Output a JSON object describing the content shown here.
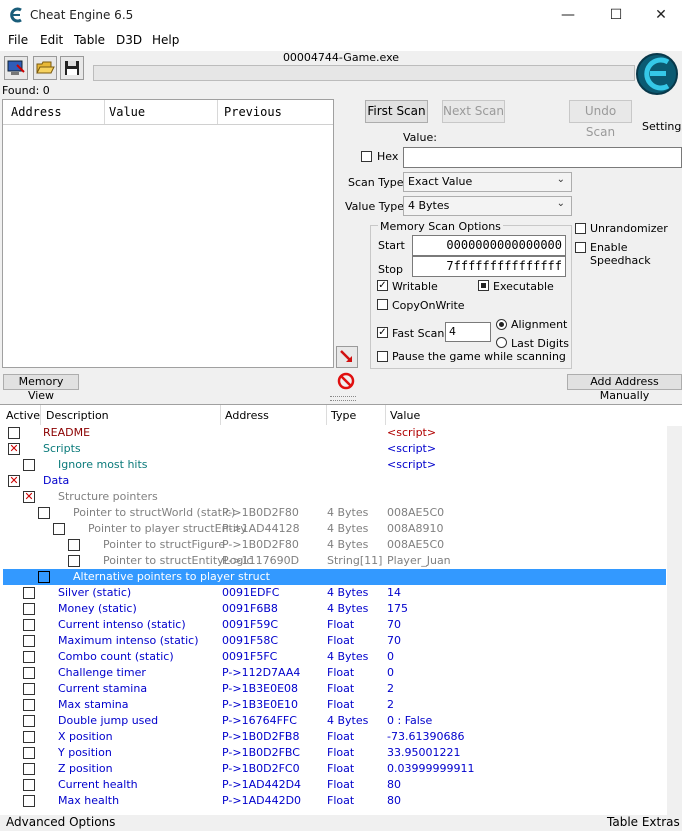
{
  "window": {
    "title": "Cheat Engine 6.5",
    "minimize": "—",
    "maximize": "☐",
    "close": "✕"
  },
  "menu": [
    "File",
    "Edit",
    "Table",
    "D3D",
    "Help"
  ],
  "process": "00004744-Game.exe",
  "found_label": "Found: 0",
  "logo_label": "Settings",
  "results": {
    "columns": [
      "Address",
      "Value",
      "Previous"
    ]
  },
  "scan": {
    "first_scan": "First Scan",
    "next_scan": "Next Scan",
    "undo_scan": "Undo Scan",
    "value_label": "Value:",
    "hex_label": "Hex",
    "scan_type_label": "Scan Type",
    "scan_type_value": "Exact Value",
    "value_type_label": "Value Type",
    "value_type_value": "4 Bytes",
    "memory_options_label": "Memory Scan Options",
    "start_label": "Start",
    "start_value": "0000000000000000",
    "stop_label": "Stop",
    "stop_value": "7fffffffffffffff",
    "writable_label": "Writable",
    "executable_label": "Executable",
    "copyonwrite_label": "CopyOnWrite",
    "fastscan_label": "Fast Scan",
    "fastscan_value": "4",
    "alignment_label": "Alignment",
    "lastdigits_label": "Last Digits",
    "pause_label": "Pause the game while scanning",
    "unrandomizer_label": "Unrandomizer",
    "speedhack_label": "Enable Speedhack"
  },
  "buttons": {
    "memory_view": "Memory View",
    "add_address": "Add Address Manually"
  },
  "table": {
    "columns": [
      "Active",
      "Description",
      "Address",
      "Type",
      "Value"
    ],
    "rows": [
      {
        "indent": 0,
        "check": "none",
        "desc": "README",
        "addr": "",
        "type": "",
        "value": "<script>",
        "color": "maroon",
        "valcolor": "dkred"
      },
      {
        "indent": 0,
        "check": "x",
        "desc": "Scripts",
        "addr": "",
        "type": "",
        "value": "<script>",
        "color": "green",
        "valcolor": "blue"
      },
      {
        "indent": 1,
        "check": "none",
        "desc": "Ignore most hits",
        "addr": "",
        "type": "",
        "value": "<script>",
        "color": "green",
        "valcolor": "blue"
      },
      {
        "indent": 0,
        "check": "x",
        "desc": "Data",
        "addr": "",
        "type": "",
        "value": "",
        "color": "blue",
        "valcolor": "blue"
      },
      {
        "indent": 1,
        "check": "x",
        "desc": "Structure pointers",
        "addr": "",
        "type": "",
        "value": "",
        "color": "gray",
        "valcolor": "gray"
      },
      {
        "indent": 2,
        "check": "none",
        "desc": "Pointer to structWorld (static)",
        "addr": "P->1B0D2F80",
        "type": "4 Bytes",
        "value": "008AE5C0",
        "color": "gray",
        "valcolor": "gray"
      },
      {
        "indent": 3,
        "check": "none",
        "desc": "Pointer to player structEntity",
        "addr": "P->1AD44128",
        "type": "4 Bytes",
        "value": "008A8910",
        "color": "gray",
        "valcolor": "gray"
      },
      {
        "indent": 4,
        "check": "none",
        "desc": "Pointer to structFigure",
        "addr": "P->1B0D2F80",
        "type": "4 Bytes",
        "value": "008AE5C0",
        "color": "gray",
        "valcolor": "gray"
      },
      {
        "indent": 4,
        "check": "none",
        "desc": "Pointer to structEntityLogic",
        "addr": "P->1117690D",
        "type": "String[11]",
        "value": "Player_Juan",
        "color": "gray",
        "valcolor": "gray"
      },
      {
        "indent": 2,
        "check": "none",
        "desc": "Alternative pointers to player struct",
        "addr": "",
        "type": "",
        "value": "",
        "color": "sel",
        "valcolor": "sel",
        "selected": true
      },
      {
        "indent": 1,
        "check": "none",
        "desc": "Silver (static)",
        "addr": "0091EDFC",
        "type": "4 Bytes",
        "value": "14",
        "color": "blue",
        "valcolor": "blue"
      },
      {
        "indent": 1,
        "check": "none",
        "desc": "Money (static)",
        "addr": "0091F6B8",
        "type": "4 Bytes",
        "value": "175",
        "color": "blue",
        "valcolor": "blue"
      },
      {
        "indent": 1,
        "check": "none",
        "desc": "Current intenso (static)",
        "addr": "0091F59C",
        "type": "Float",
        "value": "70",
        "color": "blue",
        "valcolor": "blue"
      },
      {
        "indent": 1,
        "check": "none",
        "desc": "Maximum intenso (static)",
        "addr": "0091F58C",
        "type": "Float",
        "value": "70",
        "color": "blue",
        "valcolor": "blue"
      },
      {
        "indent": 1,
        "check": "none",
        "desc": "Combo count (static)",
        "addr": "0091F5FC",
        "type": "4 Bytes",
        "value": "0",
        "color": "blue",
        "valcolor": "blue"
      },
      {
        "indent": 1,
        "check": "none",
        "desc": "Challenge timer",
        "addr": "P->112D7AA4",
        "type": "Float",
        "value": "0",
        "color": "blue",
        "valcolor": "blue"
      },
      {
        "indent": 1,
        "check": "none",
        "desc": "Current stamina",
        "addr": "P->1B3E0E08",
        "type": "Float",
        "value": "2",
        "color": "blue",
        "valcolor": "blue"
      },
      {
        "indent": 1,
        "check": "none",
        "desc": "Max stamina",
        "addr": "P->1B3E0E10",
        "type": "Float",
        "value": "2",
        "color": "blue",
        "valcolor": "blue"
      },
      {
        "indent": 1,
        "check": "none",
        "desc": "Double jump used",
        "addr": "P->16764FFC",
        "type": "4 Bytes",
        "value": "0 : False",
        "color": "blue",
        "valcolor": "blue"
      },
      {
        "indent": 1,
        "check": "none",
        "desc": "X position",
        "addr": "P->1B0D2FB8",
        "type": "Float",
        "value": "-73.61390686",
        "color": "blue",
        "valcolor": "blue"
      },
      {
        "indent": 1,
        "check": "none",
        "desc": "Y position",
        "addr": "P->1B0D2FBC",
        "type": "Float",
        "value": "33.95001221",
        "color": "blue",
        "valcolor": "blue"
      },
      {
        "indent": 1,
        "check": "none",
        "desc": "Z position",
        "addr": "P->1B0D2FC0",
        "type": "Float",
        "value": "0.03999999911",
        "color": "blue",
        "valcolor": "blue"
      },
      {
        "indent": 1,
        "check": "none",
        "desc": "Current health",
        "addr": "P->1AD442D4",
        "type": "Float",
        "value": "80",
        "color": "blue",
        "valcolor": "blue"
      },
      {
        "indent": 1,
        "check": "none",
        "desc": "Max health",
        "addr": "P->1AD442D0",
        "type": "Float",
        "value": "80",
        "color": "blue",
        "valcolor": "blue"
      }
    ]
  },
  "status": {
    "left": "Advanced Options",
    "right": "Table Extras"
  }
}
